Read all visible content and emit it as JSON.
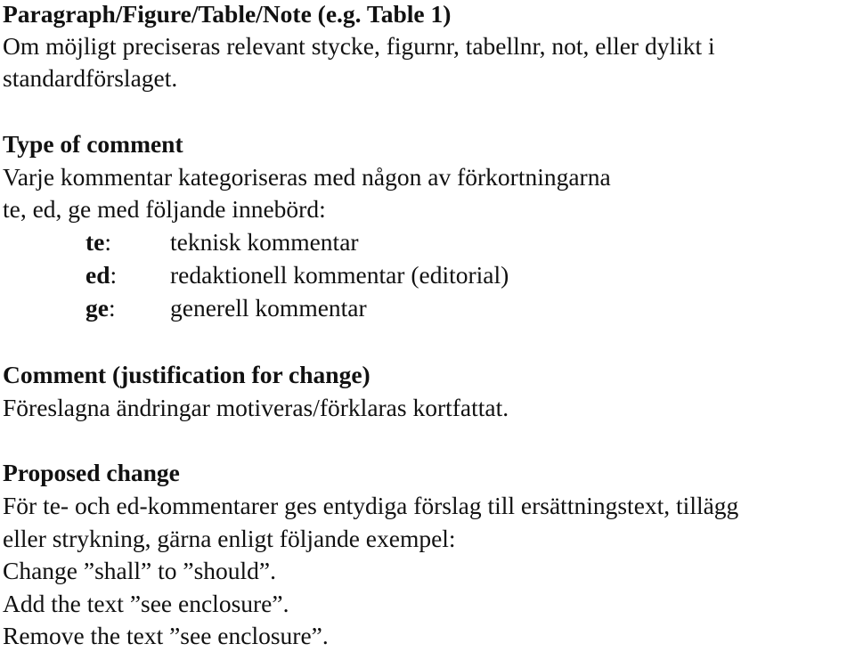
{
  "sections": {
    "paragraph": {
      "heading": "Paragraph/Figure/Table/Note (e.g. Table 1)",
      "lines": [
        "Om möjligt preciseras relevant stycke, figurnr, tabellnr, not, eller dylikt i",
        "standardförslaget."
      ]
    },
    "type": {
      "heading": "Type of comment",
      "lines": [
        "Varje kommentar kategoriseras med någon av förkortningarna",
        "te, ed, ge med följande innebörd:"
      ],
      "definitions": [
        {
          "abbr": "te",
          "colon": ":",
          "meaning": "teknisk kommentar"
        },
        {
          "abbr": "ed",
          "colon": ":",
          "meaning": "redaktionell kommentar (editorial)"
        },
        {
          "abbr": "ge",
          "colon": ":",
          "meaning": "generell kommentar"
        }
      ]
    },
    "comment": {
      "heading": "Comment (justification for change)",
      "lines": [
        "Föreslagna ändringar motiveras/förklaras kortfattat."
      ]
    },
    "proposed": {
      "heading": "Proposed change",
      "lines": [
        "För te- och ed-kommentarer ges entydiga förslag till ersättningstext, tillägg",
        "eller strykning, gärna enligt följande exempel:",
        "Change ”shall” to ”should”.",
        "Add the text ”see enclosure”.",
        "Remove the text ”see enclosure”."
      ]
    }
  }
}
